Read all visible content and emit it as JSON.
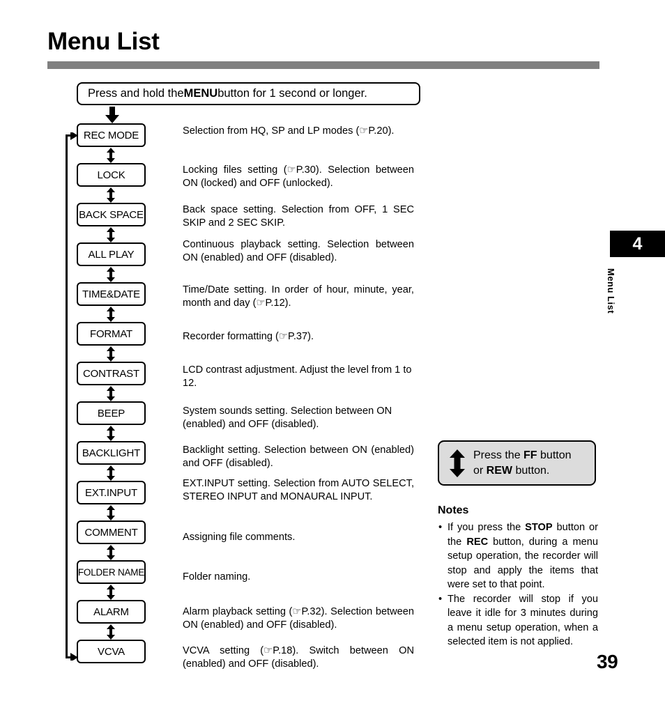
{
  "page": {
    "title": "Menu List",
    "number": "39"
  },
  "chapter_tab": {
    "number": "4",
    "label": "Menu List"
  },
  "header_box": {
    "text_before": "Press and hold the ",
    "strong": "MENU",
    "text_after": " button for 1 second or longer."
  },
  "flow": {
    "items": [
      {
        "box": "REC MODE",
        "description": "Selection from  HQ, SP and LP modes (☞P.20)."
      },
      {
        "box": "LOCK",
        "description": "Locking files setting (☞P.30). Selection between ON (locked) and OFF (unlocked)."
      },
      {
        "box": "BACK SPACE",
        "description": "Back space setting. Selection from OFF, 1 SEC SKIP and 2 SEC SKIP."
      },
      {
        "box": "ALL PLAY",
        "description": "Continuous playback setting. Selection between ON (enabled) and OFF (disabled)."
      },
      {
        "box": "TIME&DATE",
        "description": "Time/Date setting. In order of hour, minute, year, month and day (☞P.12)."
      },
      {
        "box": "FORMAT",
        "description": "Recorder formatting (☞P.37)."
      },
      {
        "box": "CONTRAST",
        "description": "LCD contrast adjustment. Adjust the level from 1 to 12."
      },
      {
        "box": "BEEP",
        "description": "System sounds setting. Selection between ON (enabled) and OFF (disabled)."
      },
      {
        "box": "BACKLIGHT",
        "description": "Backlight setting. Selection between ON (enabled) and OFF (disabled)."
      },
      {
        "box": "EXT.INPUT",
        "description": "EXT.INPUT setting. Selection from AUTO SELECT, STEREO INPUT and MONAURAL INPUT."
      },
      {
        "box": "COMMENT",
        "description": "Assigning file comments."
      },
      {
        "box": "FOLDER NAME",
        "description": "Folder naming."
      },
      {
        "box": "ALARM",
        "description": "Alarm playback setting (☞P.32). Selection between ON (enabled) and OFF (disabled)."
      },
      {
        "box": "VCVA",
        "description": "VCVA setting (☞P.18).  Switch between ON (enabled) and OFF (disabled)."
      }
    ]
  },
  "callout": {
    "line1_before": "Press the ",
    "line1_strong": "FF",
    "line1_after": " button",
    "line2_before": "or ",
    "line2_strong": "REW",
    "line2_after": " button."
  },
  "notes": {
    "title": "Notes",
    "bullet": "•",
    "items": [
      {
        "part1": "If you press the ",
        "strong1": "STOP",
        "part2": " button or the ",
        "strong2": "REC",
        "part3": " button, during a menu setup operation, the recorder will stop and apply the items that were set to that point."
      },
      {
        "part1": "The recorder will stop if you leave it idle for 3 minutes during a menu setup operation, when a selected item is not applied.",
        "strong1": "",
        "part2": "",
        "strong2": "",
        "part3": ""
      }
    ]
  },
  "colors": {
    "rule": "#808080",
    "callout_fill": "#dcdcdc",
    "tab_fill": "#000000"
  }
}
